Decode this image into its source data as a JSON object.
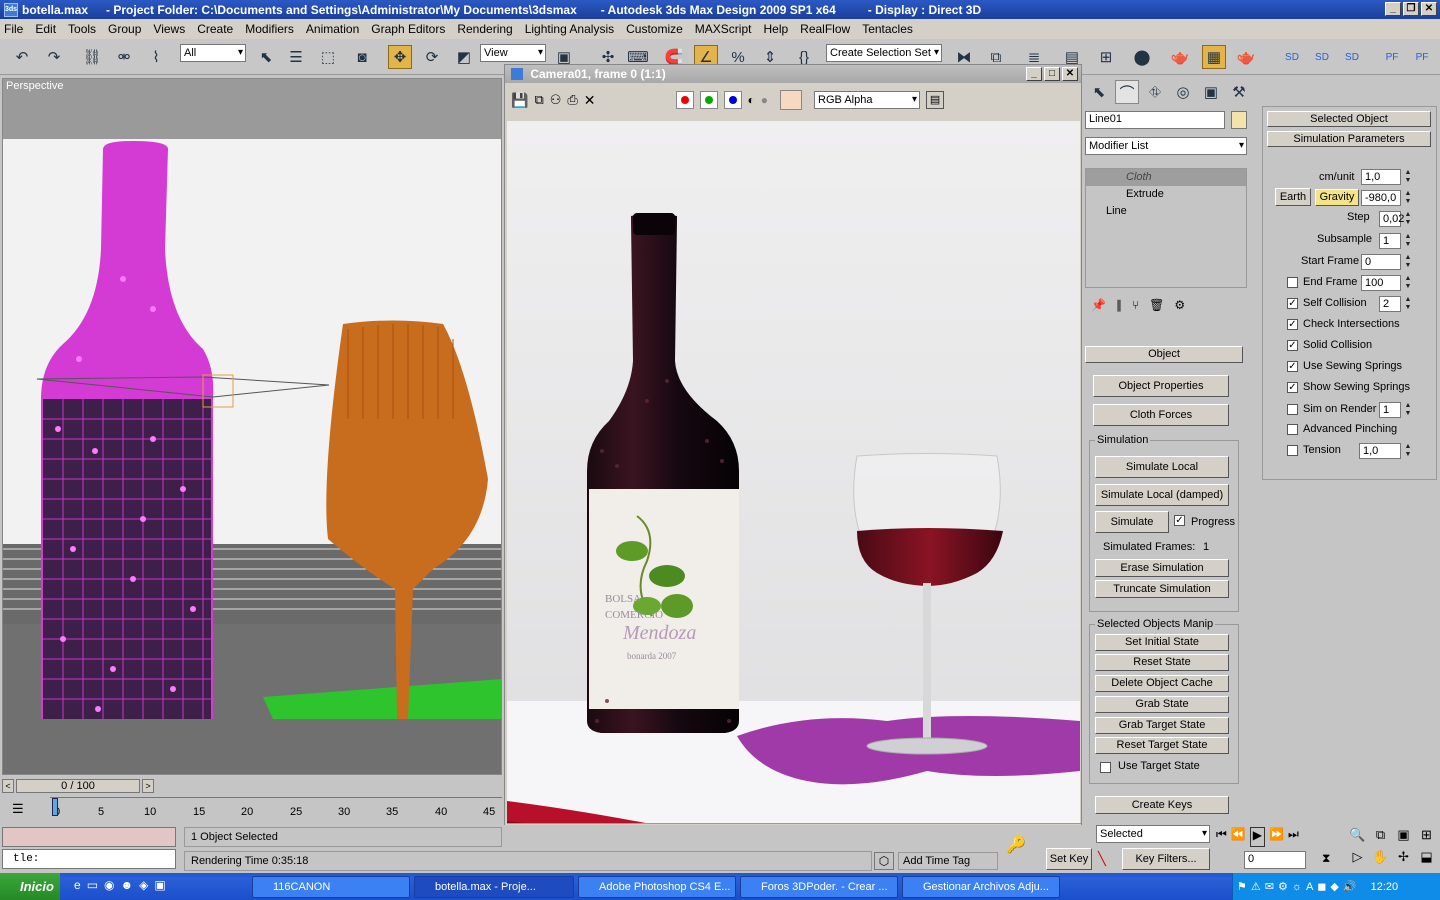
{
  "titlebar": {
    "file": "botella.max",
    "project": "- Project Folder: C:\\Documents and Settings\\Administrator\\My Documents\\3dsmax",
    "app": "- Autodesk 3ds Max Design 2009 SP1  x64",
    "display": "- Display : Direct 3D"
  },
  "menu": [
    "File",
    "Edit",
    "Tools",
    "Group",
    "Views",
    "Create",
    "Modifiers",
    "Animation",
    "Graph Editors",
    "Rendering",
    "Lighting Analysis",
    "Customize",
    "MAXScript",
    "Help",
    "RealFlow",
    "Tentacles"
  ],
  "toolbar": {
    "filter": "All",
    "refcoord": "View",
    "selection_set_placeholder": "Create Selection Set"
  },
  "viewport": {
    "label": "Perspective"
  },
  "render": {
    "title": "Camera01, frame 0 (1:1)",
    "channel": "RGB Alpha",
    "swatch_color": "#f7d8c0"
  },
  "modify": {
    "object_name": "Line01",
    "modifier_list": "Modifier List",
    "stack": [
      "Cloth",
      "Extrude",
      "Line"
    ],
    "object_rollout": "Object",
    "btn_object_properties": "Object Properties",
    "btn_cloth_forces": "Cloth Forces",
    "sim_group": "Simulation",
    "btn_sim_local": "Simulate Local",
    "btn_sim_local_damped": "Simulate Local (damped)",
    "btn_simulate": "Simulate",
    "progress_label": "Progress",
    "sim_frames_label": "Simulated Frames:",
    "sim_frames_value": "1",
    "btn_erase": "Erase Simulation",
    "btn_truncate": "Truncate Simulation",
    "manip_group": "Selected Objects Manip",
    "btn_set_initial": "Set Initial State",
    "btn_reset_state": "Reset State",
    "btn_delete_cache": "Delete Object Cache",
    "btn_grab_state": "Grab State",
    "btn_grab_target": "Grab Target State",
    "btn_reset_target": "Reset Target State",
    "use_target_label": "Use Target State",
    "btn_create_keys": "Create Keys"
  },
  "sim_params": {
    "selected_object": "Selected Object",
    "title": "Simulation Parameters",
    "cm_unit_label": "cm/unit",
    "cm_unit": "1,0",
    "earth": "Earth",
    "gravity": "Gravity",
    "gravity_value": "-980,0",
    "step_label": "Step",
    "step": "0,02",
    "subsample_label": "Subsample",
    "subsample": "1",
    "start_frame_label": "Start Frame",
    "start_frame": "0",
    "end_frame_label": "End Frame",
    "end_frame": "100",
    "self_collision_label": "Self Collision",
    "self_collision": "2",
    "check_intersections": "Check Intersections",
    "solid_collision": "Solid Collision",
    "use_sewing": "Use Sewing Springs",
    "show_sewing": "Show Sewing Springs",
    "sim_on_render": "Sim on Render",
    "sim_on_render_value": "1",
    "adv_pinching": "Advanced Pinching",
    "tension": "Tension",
    "tension_value": "1,0"
  },
  "timeline": {
    "slider": "0 / 100",
    "ticks": [
      "0",
      "5",
      "10",
      "15",
      "20",
      "25",
      "30",
      "35",
      "40",
      "45"
    ]
  },
  "status": {
    "selected": "1 Object Selected",
    "render_time": "Rendering Time  0:35:18",
    "maxscript": "tle:",
    "add_time_tag": "Add Time Tag",
    "set_key": "Set Key",
    "key_filters": "Key Filters...",
    "key_mode": "Selected",
    "frame": "0"
  },
  "taskbar": {
    "start": "Inicio",
    "tasks": [
      "116CANON",
      "botella.max    - Proje...",
      "Adobe Photoshop CS4 E...",
      "Foros 3DPoder. - Crear ...",
      "Gestionar Archivos Adju..."
    ],
    "clock": "12:20"
  }
}
